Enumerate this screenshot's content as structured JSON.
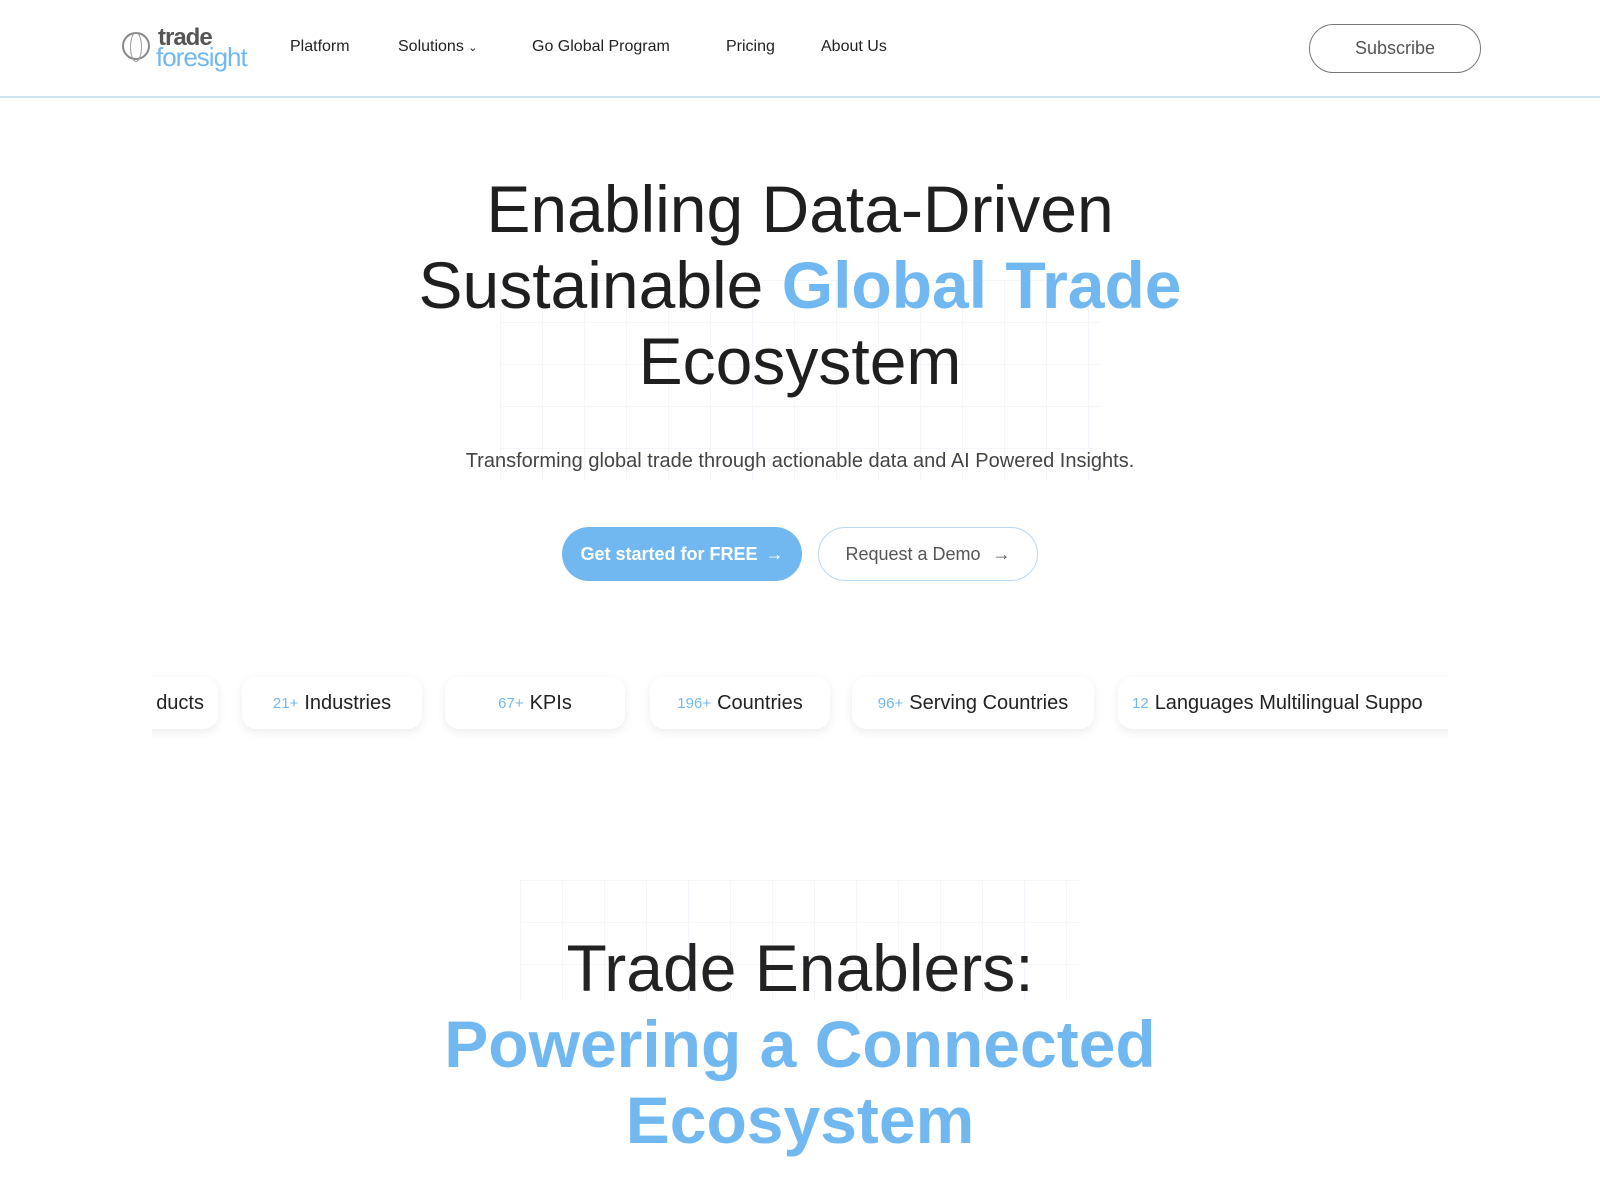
{
  "brand": {
    "logo_top": "trade",
    "logo_bottom": "foresight"
  },
  "nav": {
    "items": [
      {
        "label": "Platform"
      },
      {
        "label": "Solutions"
      },
      {
        "label": "Go Global Program"
      },
      {
        "label": "Pricing"
      },
      {
        "label": "About Us"
      }
    ],
    "subscribe": "Subscribe"
  },
  "hero": {
    "line1": "Enabling Data-Driven",
    "line2_plain": "Sustainable ",
    "line2_accent": "Global Trade",
    "line3": "Ecosystem",
    "subtitle": "Transforming global trade through actionable data and AI Powered Insights.",
    "cta_primary": "Get started for FREE",
    "cta_secondary": "Request a Demo"
  },
  "stats": [
    {
      "num": "",
      "label": "ducts"
    },
    {
      "num": "21+",
      "label": "Industries"
    },
    {
      "num": "67+",
      "label": "KPIs"
    },
    {
      "num": "196+",
      "label": "Countries"
    },
    {
      "num": "96+",
      "label": "Serving Countries"
    },
    {
      "num": "12",
      "label": "Languages Multilingual Suppo"
    }
  ],
  "enablers": {
    "line1": "Trade Enablers:",
    "line2": "Powering a Connected",
    "line3": "Ecosystem"
  },
  "colors": {
    "accent": "#72b8f0",
    "text": "#1f1f1f"
  }
}
